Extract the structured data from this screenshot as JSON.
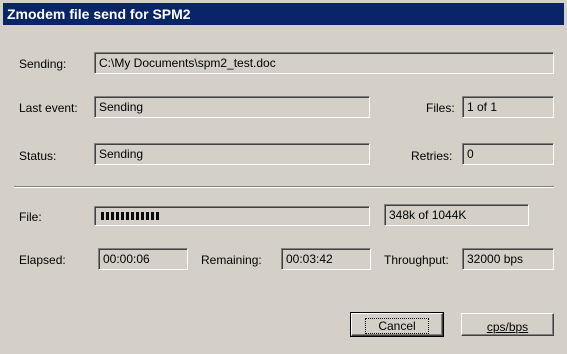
{
  "window": {
    "title": "Zmodem file send for SPM2"
  },
  "labels": {
    "sending": "Sending:",
    "last_event": "Last event:",
    "files": "Files:",
    "status": "Status:",
    "retries": "Retries:",
    "file": "File:",
    "elapsed": "Elapsed:",
    "remaining": "Remaining:",
    "throughput": "Throughput:"
  },
  "values": {
    "sending_path": "C:\\My Documents\\spm2_test.doc",
    "last_event": "Sending",
    "files": "1 of 1",
    "status": "Sending",
    "retries": "0",
    "file_size": "348k of 1044K",
    "elapsed": "00:00:06",
    "remaining": "00:03:42",
    "throughput": "32000 bps"
  },
  "progress": {
    "fraction": 0.333
  },
  "buttons": {
    "cancel": "Cancel",
    "cps_bps": "cps/bps"
  },
  "colors": {
    "titlebar": "#0a246a",
    "face": "#d4d0c8"
  }
}
